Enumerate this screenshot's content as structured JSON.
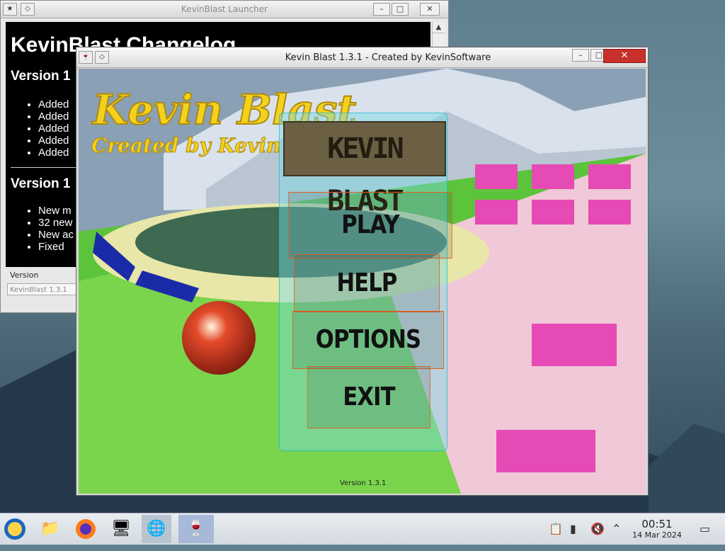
{
  "launcher": {
    "title": "KevinBlast Launcher",
    "changelog": {
      "heading": "KevinBlast Changelog",
      "sections": [
        {
          "title": "Version 1",
          "items": [
            "Added",
            "Added",
            "Added",
            "Added",
            "Added"
          ]
        },
        {
          "title": "Version 1",
          "items": [
            "New m",
            "32 new",
            "New ac",
            "Fixed"
          ]
        }
      ]
    },
    "version_label": "Version",
    "version_value": "KevinBlast 1.3.1"
  },
  "game": {
    "title": "Kevin Blast 1.3.1 - Created by KevinSoftware",
    "logo_title": "Kevin Blast",
    "logo_subtitle": "Created by Kevin",
    "banner": "KEVIN BLAST",
    "menu": {
      "play": "PLAY",
      "help": "HELP",
      "options": "OPTIONS",
      "exit": "EXIT"
    },
    "version": "Version 1.3.1"
  },
  "taskbar": {
    "time": "00:51",
    "date": "14 Mar 2024"
  },
  "colors": {
    "close_button": "#c9302c",
    "menu_panel": "#78dce6",
    "menu_border": "#e06020",
    "logo": "#f3d21f"
  }
}
